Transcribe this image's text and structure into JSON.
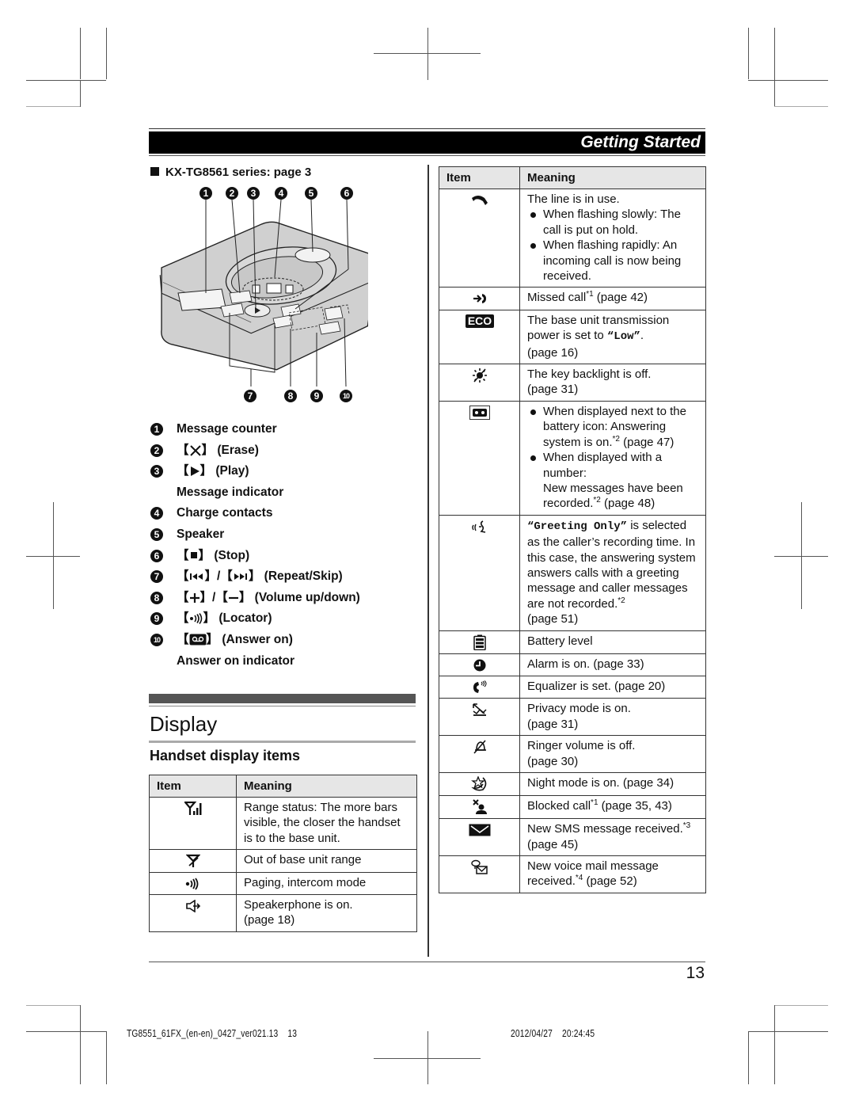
{
  "header": {
    "section_title": "Getting Started"
  },
  "left_column": {
    "series_heading": "KX-TG8561 series: page 3",
    "diagram_callouts_top": [
      "1",
      "2",
      "3",
      "4",
      "5",
      "6"
    ],
    "diagram_callouts_bottom": [
      "7",
      "8",
      "9",
      "10"
    ],
    "legend": [
      {
        "num": "1",
        "key_icon": "",
        "text": "Message counter"
      },
      {
        "num": "2",
        "key_icon": "erase-key-icon",
        "text": "(Erase)"
      },
      {
        "num": "3",
        "key_icon": "play-key-icon",
        "text": "(Play)"
      },
      {
        "num": "",
        "key_icon": "",
        "text": "Message indicator"
      },
      {
        "num": "4",
        "key_icon": "",
        "text": "Charge contacts"
      },
      {
        "num": "5",
        "key_icon": "",
        "text": "Speaker"
      },
      {
        "num": "6",
        "key_icon": "stop-key-icon",
        "text": "(Stop)"
      },
      {
        "num": "7",
        "key_icon": "repeat-skip-key-icon",
        "text": "(Repeat/Skip)"
      },
      {
        "num": "8",
        "key_icon": "volume-key-icon",
        "text": "(Volume up/down)"
      },
      {
        "num": "9",
        "key_icon": "locator-key-icon",
        "text": "(Locator)"
      },
      {
        "num": "10",
        "key_icon": "answer-on-key-icon",
        "text": "(Answer on)"
      },
      {
        "num": "",
        "key_icon": "",
        "text": "Answer on indicator"
      }
    ],
    "section_title": "Display",
    "subsection_title": "Handset display items",
    "table": {
      "headers": [
        "Item",
        "Meaning"
      ],
      "rows": [
        {
          "icon": "range-status-icon",
          "meaning": "Range status: The more bars visible, the closer the handset is to the base unit."
        },
        {
          "icon": "out-of-range-icon",
          "meaning": "Out of base unit range"
        },
        {
          "icon": "paging-icon",
          "meaning": "Paging, intercom mode"
        },
        {
          "icon": "speakerphone-icon",
          "meaning": "Speakerphone is on.",
          "meaning2": "(page 18)"
        }
      ]
    }
  },
  "right_column": {
    "table": {
      "headers": [
        "Item",
        "Meaning"
      ],
      "rows": [
        {
          "icon": "line-in-use-icon",
          "meaning": "The line is in use.",
          "bullets": [
            "When flashing slowly: The call is put on hold.",
            "When flashing rapidly: An incoming call is now being received."
          ]
        },
        {
          "icon": "missed-call-icon",
          "meaning": "Missed call",
          "sup": "*1",
          "after": " (page 42)"
        },
        {
          "icon": "eco-icon",
          "icon_text": "ECO",
          "meaning": "The base unit transmission power is set to ",
          "mono": "“Low”",
          "after": ".",
          "line2": "(page 16)"
        },
        {
          "icon": "backlight-off-icon",
          "meaning": "The key backlight is off.",
          "line2": "(page 31)"
        },
        {
          "icon": "answering-system-icon",
          "bullets_sup": [
            {
              "text": "When displayed next to the battery icon: Answering system is on.",
              "sup": "*2",
              "after": " (page 47)"
            },
            {
              "text": "When displayed with a number:",
              "line2": "New messages have been recorded.",
              "sup": "*2",
              "after": " (page 48)"
            }
          ]
        },
        {
          "icon": "greeting-only-icon",
          "mono": "“Greeting Only”",
          "meaning": " is selected as the caller’s recording time. In this case, the answering system answers calls with a greeting message and caller messages are not recorded.",
          "sup": "*2",
          "line2": "(page 51)"
        },
        {
          "icon": "battery-level-icon",
          "meaning": "Battery level"
        },
        {
          "icon": "alarm-icon",
          "meaning": "Alarm is on. (page 33)"
        },
        {
          "icon": "equalizer-icon",
          "meaning": "Equalizer is set. (page 20)"
        },
        {
          "icon": "privacy-mode-icon",
          "meaning": "Privacy mode is on.",
          "line2": "(page 31)"
        },
        {
          "icon": "ringer-off-icon",
          "meaning": "Ringer volume is off.",
          "line2": "(page 30)"
        },
        {
          "icon": "night-mode-icon",
          "meaning": "Night mode is on. (page 34)"
        },
        {
          "icon": "blocked-call-icon",
          "meaning": "Blocked call",
          "sup": "*1",
          "after": " (page 35, 43)"
        },
        {
          "icon": "sms-icon",
          "meaning": "New SMS message received.",
          "sup": "*3",
          "after": " (page 45)"
        },
        {
          "icon": "voice-mail-icon",
          "meaning": "New voice mail message received.",
          "sup": "*4",
          "after": " (page 52)"
        }
      ]
    }
  },
  "footer": {
    "page_number": "13",
    "print_file": "TG8551_61FX_(en-en)_0427_ver021.13    13",
    "print_datetime": "2012/04/27    20:24:45"
  }
}
